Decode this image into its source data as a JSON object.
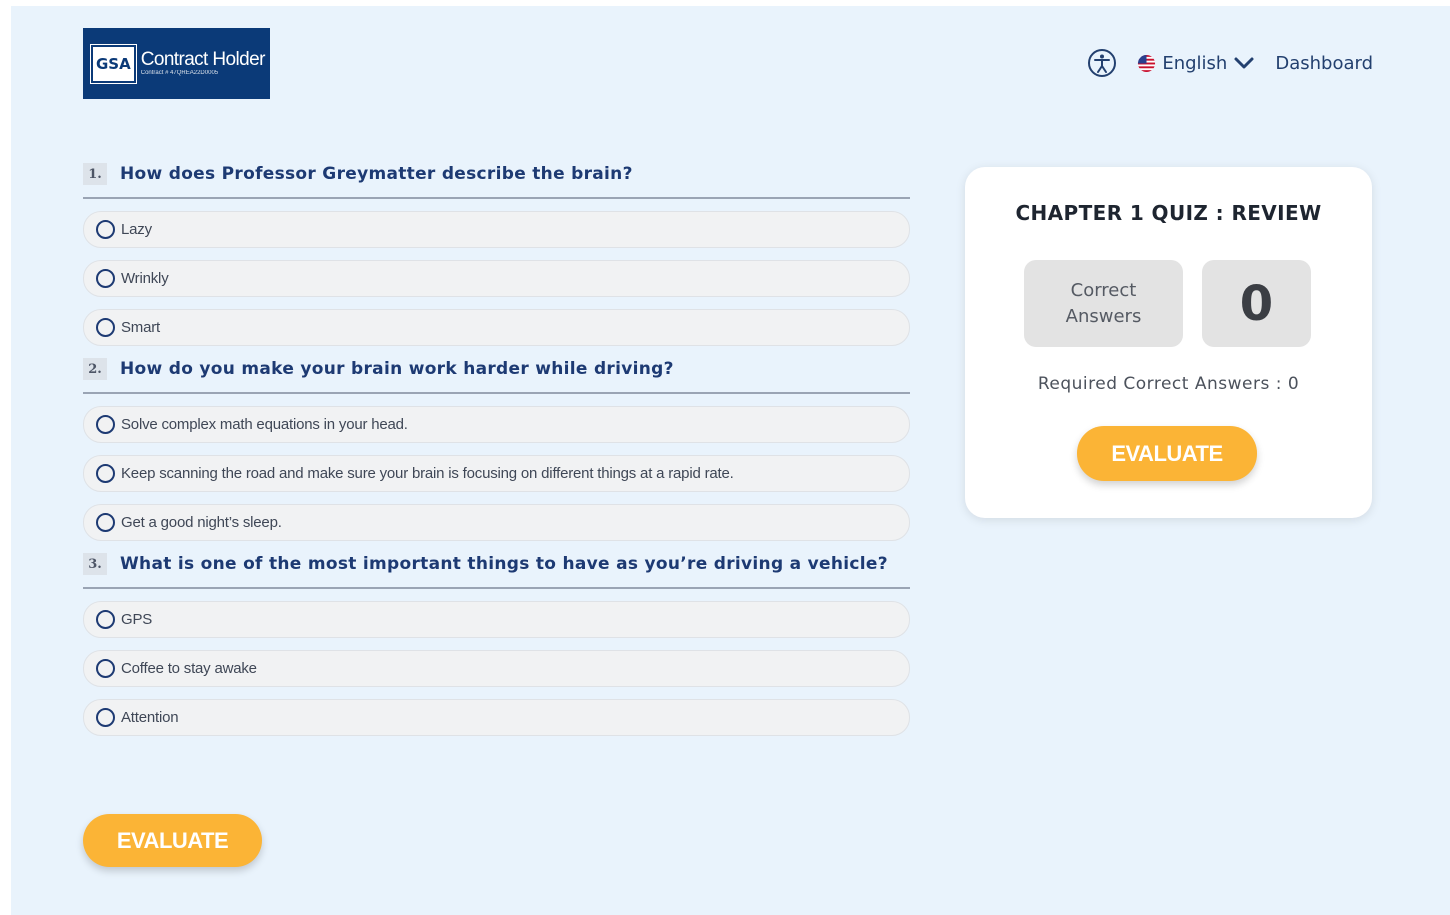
{
  "header": {
    "logo": {
      "brand": "GSA",
      "title": "Contract Holder",
      "subtitle": "Contract # 47QREA22D0005"
    },
    "language": "English",
    "dashboard_label": "Dashboard",
    "icons": [
      "accessibility-icon",
      "us-flag-icon",
      "chevron-down-icon"
    ]
  },
  "questions": [
    {
      "number": "1.",
      "text": "How does Professor Greymatter describe the brain?",
      "options": [
        "Lazy",
        "Wrinkly",
        "Smart"
      ]
    },
    {
      "number": "2.",
      "text": "How do you make your brain work harder while driving?",
      "options": [
        "Solve complex math equations in your head.",
        "Keep scanning the road and make sure your brain is focusing on different things at a rapid rate.",
        "Get a good night’s sleep."
      ]
    },
    {
      "number": "3.",
      "text": "What is one of the most important things to have as you’re driving a vehicle?",
      "options": [
        "GPS",
        "Coffee to stay awake",
        "Attention"
      ]
    }
  ],
  "evaluate_label": "EVALUATE",
  "review": {
    "title": "CHAPTER 1 QUIZ : REVIEW",
    "correct_label": "Correct Answers",
    "correct_count": "0",
    "required_text": "Required Correct Answers : 0",
    "evaluate_label": "EVALUATE"
  },
  "colors": {
    "page_bg": "#e9f3fc",
    "accent": "#fbb436",
    "navy": "#1d3a73",
    "logo_bg": "#0b3a78"
  }
}
